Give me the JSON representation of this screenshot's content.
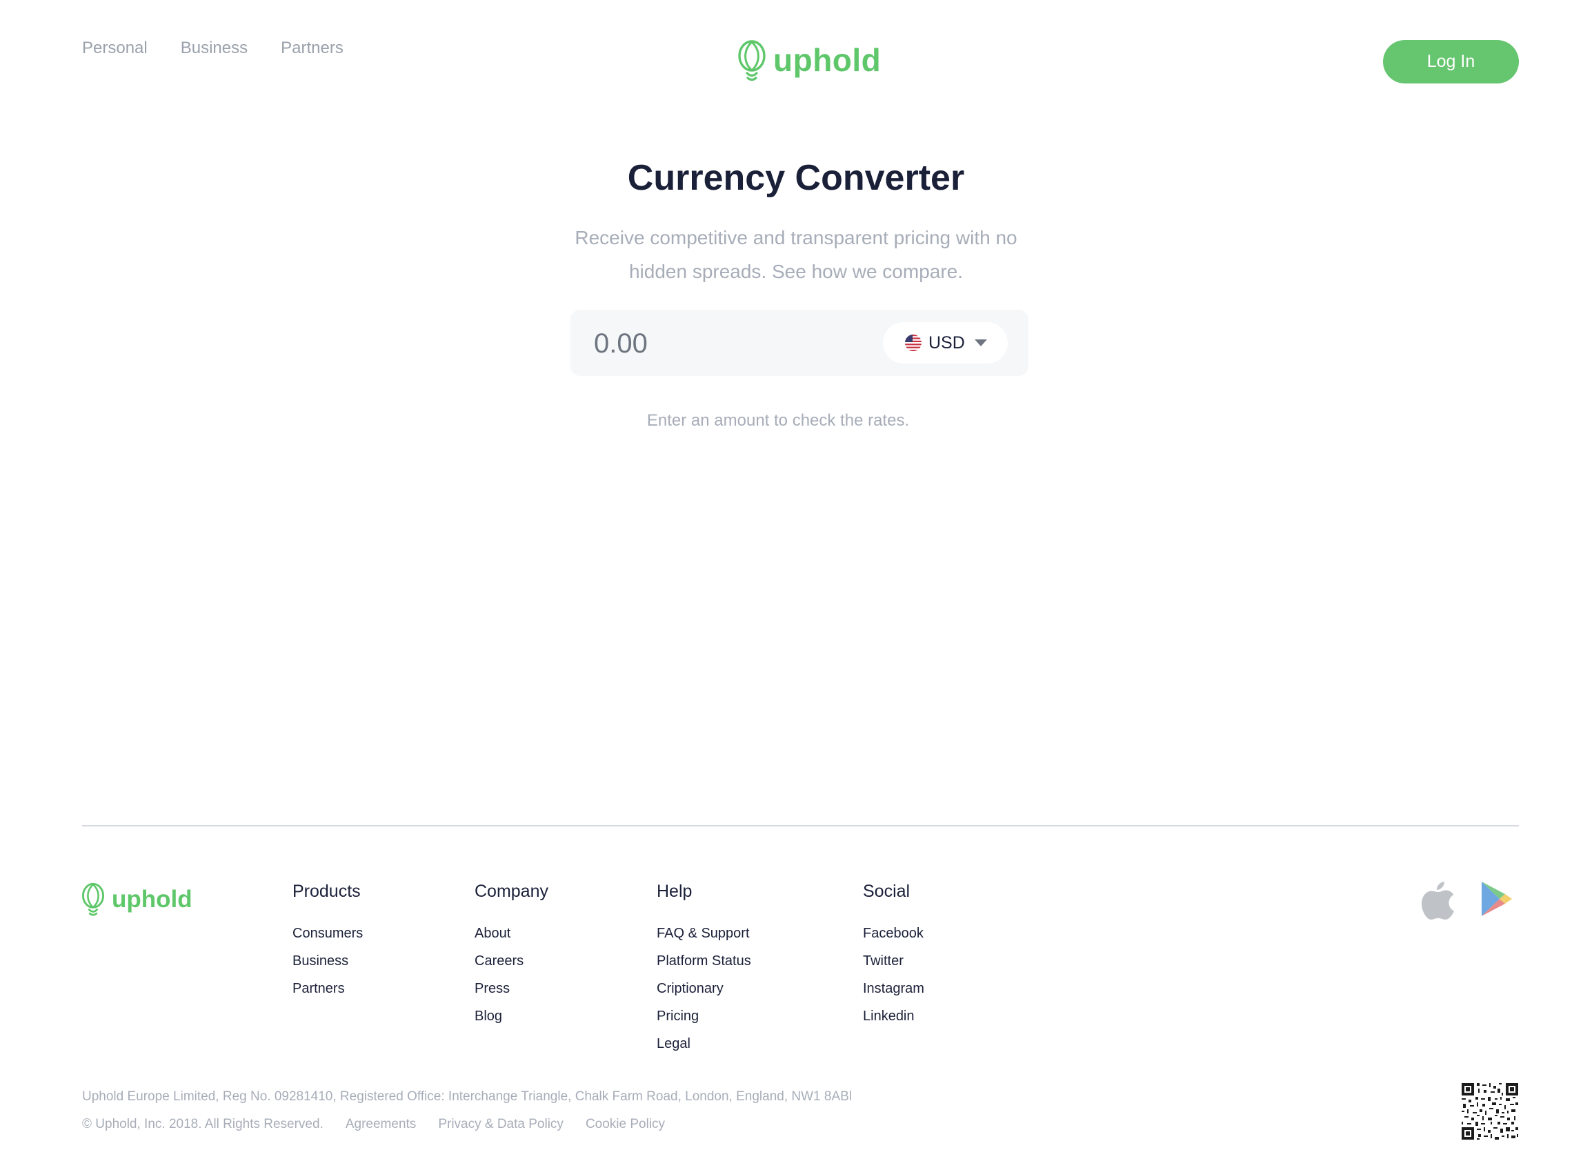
{
  "header": {
    "nav": [
      "Personal",
      "Business",
      "Partners"
    ],
    "brand": "uphold",
    "login_label": "Log In"
  },
  "main": {
    "title": "Currency Converter",
    "subtitle": "Receive competitive and transparent pricing with no hidden spreads. See how we compare.",
    "amount_placeholder": "0.00",
    "currency": {
      "code": "USD",
      "flag_icon": "us-flag-icon"
    },
    "hint": "Enter an amount to check the rates."
  },
  "footer": {
    "brand": "uphold",
    "columns": {
      "products": {
        "heading": "Products",
        "items": [
          "Consumers",
          "Business",
          "Partners"
        ]
      },
      "company": {
        "heading": "Company",
        "items": [
          "About",
          "Careers",
          "Press",
          "Blog"
        ]
      },
      "help": {
        "heading": "Help",
        "items": [
          "FAQ & Support",
          "Platform Status",
          "Criptionary",
          "Pricing",
          "Legal"
        ]
      },
      "social": {
        "heading": "Social",
        "items": [
          "Facebook",
          "Twitter",
          "Instagram",
          "Linkedin"
        ]
      }
    },
    "app_icons": [
      "apple-icon",
      "google-play-icon"
    ],
    "legal_line": "Uphold Europe Limited, Reg No. 09281410, Registered Office: Interchange Triangle, Chalk Farm Road, London, England, NW1 8ABl",
    "copyright": "© Uphold, Inc. 2018. All Rights Reserved.",
    "legal_links": [
      "Agreements",
      "Privacy & Data Policy",
      "Cookie Policy"
    ]
  },
  "colors": {
    "brand_green": "#5ec76a",
    "button_green": "#66c56f",
    "heading": "#1b2039",
    "muted": "#a7adb8"
  }
}
